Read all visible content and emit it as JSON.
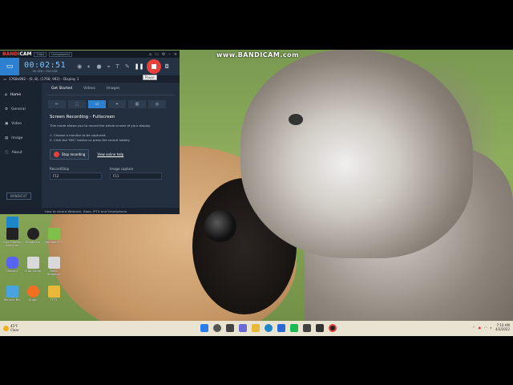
{
  "watermark": "www.BANDICAM.com",
  "bandicam": {
    "logo_red": "BANDI",
    "logo_white": "CAM",
    "badge1": "24fps",
    "badge2": "Unregistered",
    "timer": "00:02:51",
    "timer_info": "95.7KB / 700.0GB",
    "pause_tooltip": "Pause",
    "subtitle": "1768x992 - (0, 8), (1768, 992) - Display 1",
    "sidebar": [
      "Home",
      "General",
      "Video",
      "Image",
      "About"
    ],
    "bandicut": "BANDICUT",
    "tabs": [
      "Get Started",
      "Videos",
      "Images"
    ],
    "mode_title": "Screen Recording - Fullscreen",
    "mode_desc": "This mode allows you to record the whole screen of your display.",
    "steps": [
      "1. Choose a monitor to be captured.",
      "2. Click the 'REC' button or press the record hotkey."
    ],
    "stop_button": "Stop recording",
    "online_help": "View online help",
    "record_stop_label": "Record/Stop",
    "record_stop_key": "F12",
    "image_capture_label": "Image capture",
    "image_capture_key": "F11",
    "footer": "How to record Webcam, Xbox, IPTV and Smartphone"
  },
  "desktop_icons": [
    {
      "label": "Microsoft Edge",
      "color": "#1e86c8"
    },
    {
      "label": "Epic Games Launcher",
      "color": "#222222"
    },
    {
      "label": "Bandicam",
      "color": "#222222"
    },
    {
      "label": "Notepad++",
      "color": "#7fbf4a"
    },
    {
      "label": "Discord",
      "color": "#5865f2"
    },
    {
      "label": "Crab Game",
      "color": "#d9d9d9"
    },
    {
      "label": "Hello Neighbor",
      "color": "#d9d9d9"
    },
    {
      "label": "Recycle Bin",
      "color": "#4aa3df"
    },
    {
      "label": "Origin",
      "color": "#f26f21"
    },
    {
      "label": "TTT2",
      "color": "#e8b83a"
    }
  ],
  "taskbar": {
    "weather_temp": "45°F",
    "weather_desc": "Clear",
    "time": "7:10 AM",
    "date": "4/3/2022"
  }
}
